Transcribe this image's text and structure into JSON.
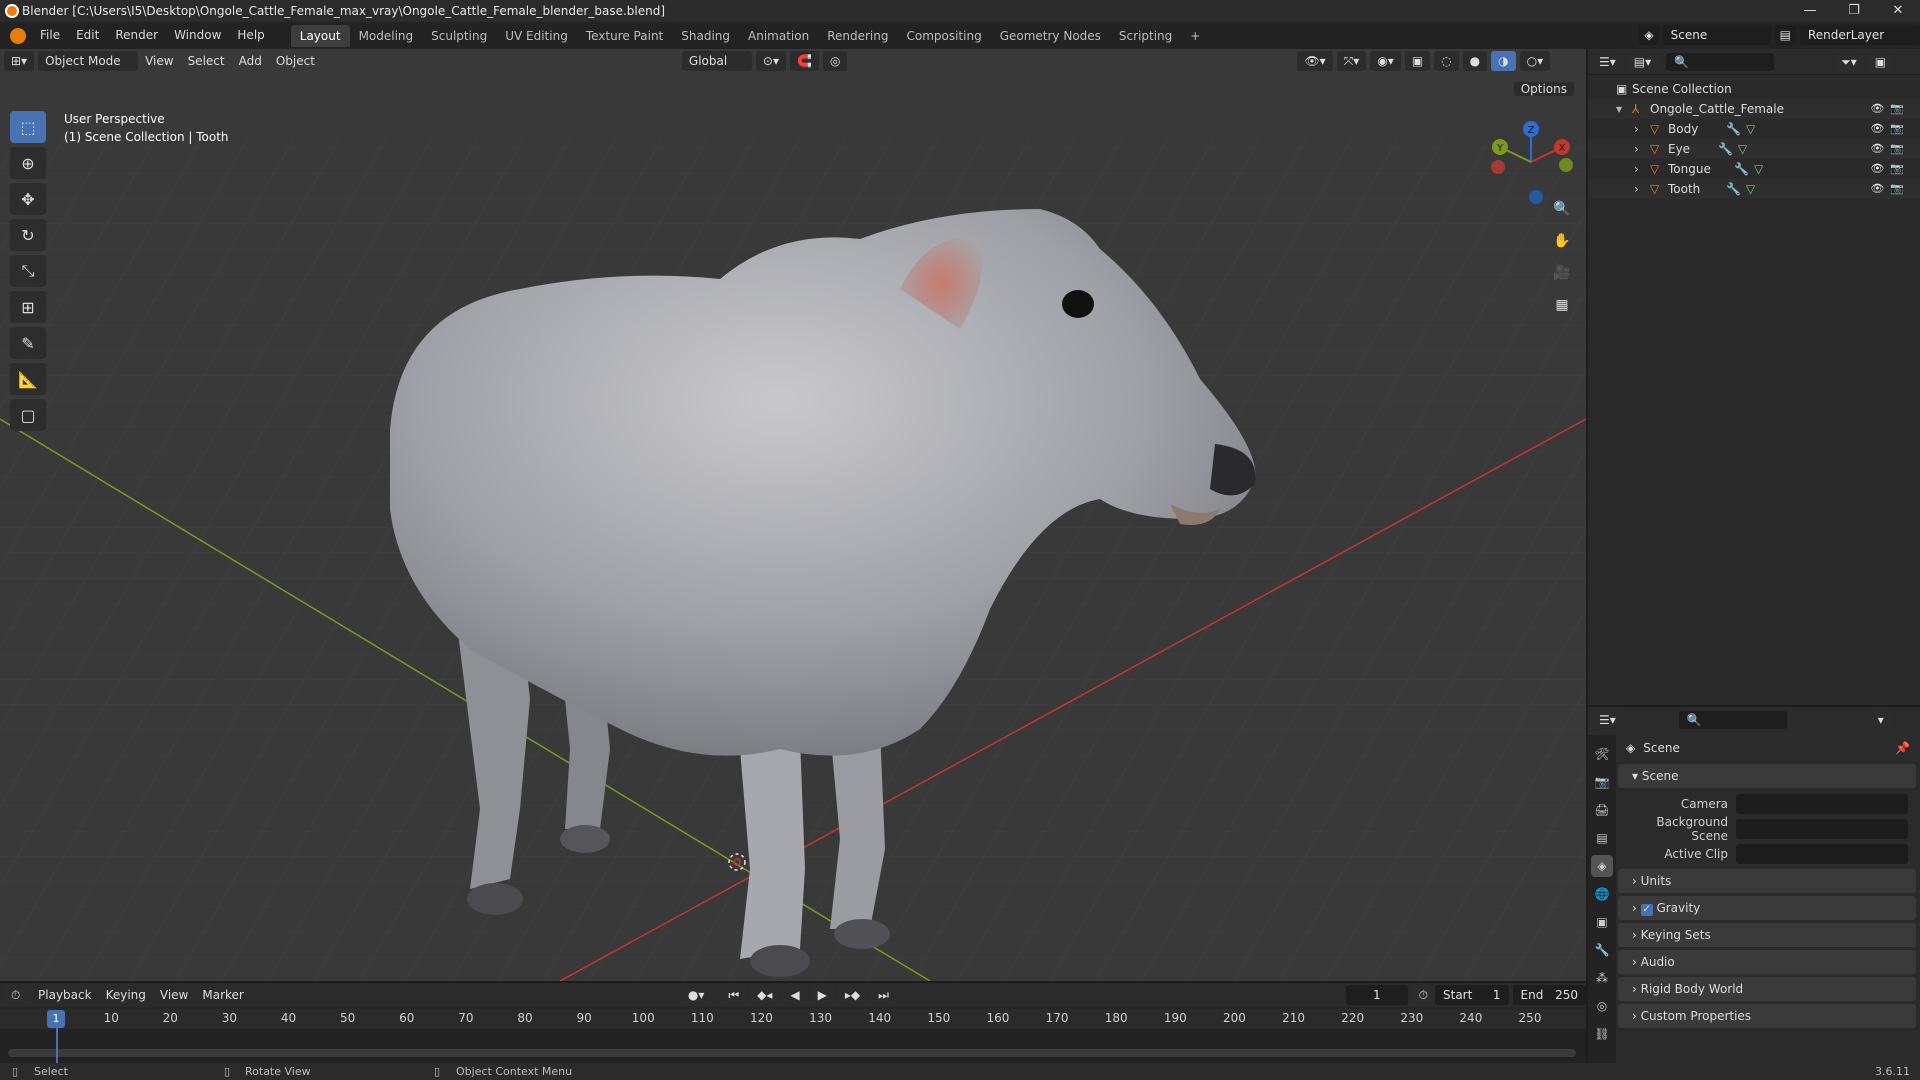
{
  "window": {
    "title": "Blender [C:\\Users\\I5\\Desktop\\Ongole_Cattle_Female_max_vray\\Ongole_Cattle_Female_blender_base.blend]",
    "controls": [
      "—",
      "❐",
      "✕"
    ]
  },
  "menu": {
    "items": [
      "File",
      "Edit",
      "Render",
      "Window",
      "Help"
    ]
  },
  "workspaces": [
    "Layout",
    "Modeling",
    "Sculpting",
    "UV Editing",
    "Texture Paint",
    "Shading",
    "Animation",
    "Rendering",
    "Compositing",
    "Geometry Nodes",
    "Scripting"
  ],
  "active_workspace": "Layout",
  "add_workspace": "+",
  "top_right": {
    "scene": "Scene",
    "render_layer": "RenderLayer"
  },
  "viewport": {
    "mode": "Object Mode",
    "menus": [
      "View",
      "Select",
      "Add",
      "Object"
    ],
    "transform_orientation": "Global",
    "options_label": "Options",
    "info_line1": "User Perspective",
    "info_line2": "(1) Scene Collection | Tooth",
    "gizmo_axes": {
      "x": "X",
      "y": "Y",
      "z": "Z"
    }
  },
  "outliner": {
    "root": "Scene Collection",
    "collection": "Ongole_Cattle_Female",
    "objects": [
      "Body",
      "Eye",
      "Tongue",
      "Tooth"
    ]
  },
  "properties": {
    "context": "Scene",
    "section": "Scene",
    "fields": {
      "camera": "Camera",
      "background_scene": "Background Scene",
      "active_clip": "Active Clip"
    },
    "panels": [
      "Units",
      "Gravity",
      "Keying Sets",
      "Audio",
      "Rigid Body World",
      "Custom Properties"
    ],
    "gravity_checked": true
  },
  "timeline": {
    "menus": [
      "Playback",
      "Keying",
      "View",
      "Marker"
    ],
    "current_frame": "1",
    "start_label": "Start",
    "start": "1",
    "end_label": "End",
    "end": "250",
    "ticks": [
      "10",
      "20",
      "30",
      "40",
      "50",
      "60",
      "70",
      "80",
      "90",
      "100",
      "110",
      "120",
      "130",
      "140",
      "150",
      "160",
      "170",
      "180",
      "190",
      "200",
      "210",
      "220",
      "230",
      "240",
      "250"
    ],
    "playhead": "1"
  },
  "status": {
    "select": "Select",
    "rotate": "Rotate View",
    "context_menu": "Object Context Menu",
    "version": "3.6.11"
  },
  "colors": {
    "accent": "#4772b3",
    "x_axis": "#c0392b",
    "y_axis": "#7a9a1d",
    "z_axis": "#2b6fd6",
    "blender_orange": "#e87d0d"
  }
}
